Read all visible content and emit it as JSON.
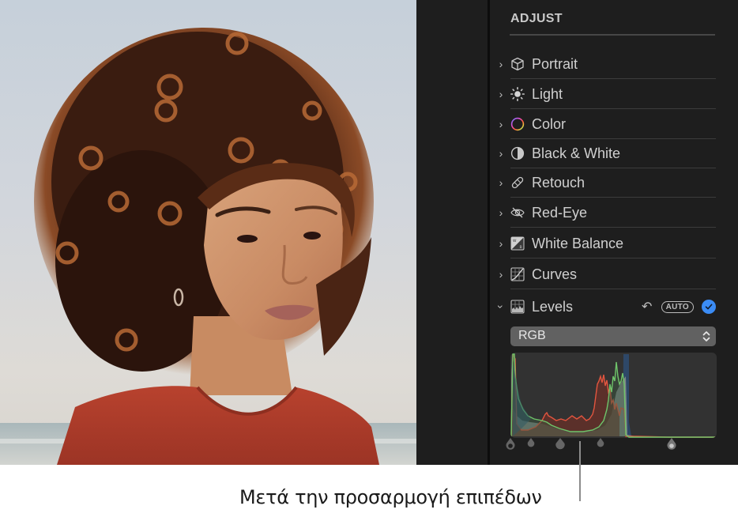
{
  "panel": {
    "title": "ADJUST",
    "items": [
      {
        "label": "Portrait",
        "icon": "cube-icon",
        "expanded": false
      },
      {
        "label": "Light",
        "icon": "sun-icon",
        "expanded": false
      },
      {
        "label": "Color",
        "icon": "color-ring-icon",
        "expanded": false
      },
      {
        "label": "Black & White",
        "icon": "half-circle-icon",
        "expanded": false
      },
      {
        "label": "Retouch",
        "icon": "bandage-icon",
        "expanded": false
      },
      {
        "label": "Red-Eye",
        "icon": "eye-slash-icon",
        "expanded": false
      },
      {
        "label": "White Balance",
        "icon": "white-balance-icon",
        "expanded": false
      },
      {
        "label": "Curves",
        "icon": "curves-icon",
        "expanded": false
      },
      {
        "label": "Levels",
        "icon": "levels-icon",
        "expanded": true
      }
    ],
    "levels": {
      "undo_icon": "undo-icon",
      "auto_label": "AUTO",
      "enabled": true,
      "channel": "RGB",
      "accent": "#3b8cf5"
    }
  },
  "histogram_colors": {
    "red": "#e2553f",
    "green": "#6fc46a",
    "blue": "#2e4a6e",
    "luminance": "#7d8486"
  },
  "caption": "Μετά την προσαρμογή επιπέδων"
}
